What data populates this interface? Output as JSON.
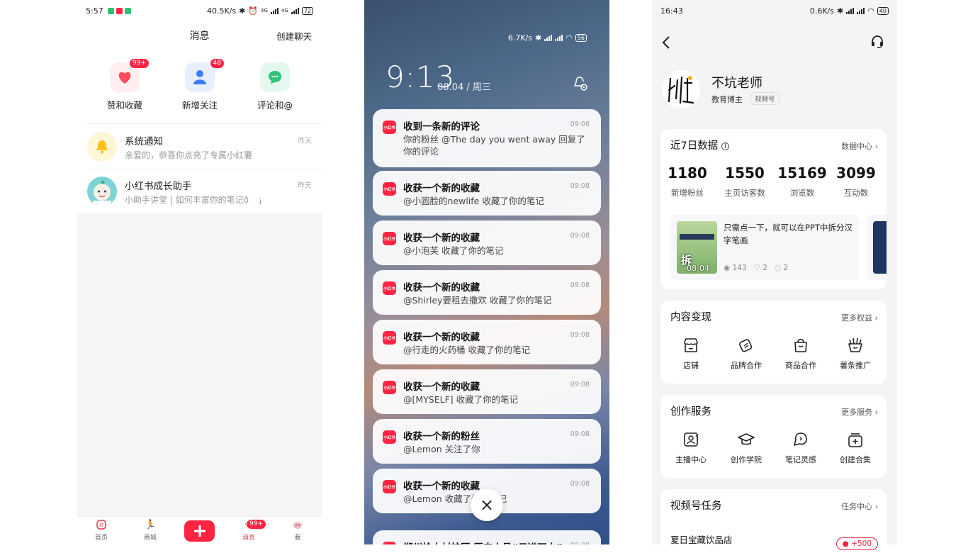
{
  "panel1": {
    "status": {
      "time": "5:57",
      "speed": "40.5K/s",
      "net1": "4G",
      "net2": "4G",
      "battery": "72"
    },
    "title": "消息",
    "create_chat": "创建聊天",
    "categories": [
      {
        "label": "赞和收藏",
        "badge": "99+",
        "icon": "heart-icon",
        "color": "#ff4d5e"
      },
      {
        "label": "新增关注",
        "badge": "48",
        "icon": "person-icon",
        "color": "#3d7cff"
      },
      {
        "label": "评论和@",
        "badge": "",
        "icon": "chat-bubble-icon",
        "color": "#2fc27c"
      }
    ],
    "messages": [
      {
        "title": "系统通知",
        "snippet": "亲爱的，恭喜你点亮了专属小红薯",
        "date": "昨天",
        "icon": "bell-icon"
      },
      {
        "title": "小红书成长助手",
        "snippet": "小助手讲堂 | 如何丰富你的笔记ð",
        "extra": "¡",
        "date": "昨天",
        "icon": "assistant-avatar-icon"
      }
    ],
    "nav": [
      {
        "label": "首页",
        "icon": "home-icon"
      },
      {
        "label": "商城",
        "icon": "mall-icon"
      },
      {
        "label": "",
        "icon": "plus-icon"
      },
      {
        "label": "消息",
        "icon": "message-icon",
        "badge": "99+"
      },
      {
        "label": "我",
        "icon": "me-icon"
      }
    ]
  },
  "panel2": {
    "status": {
      "speed": "6.7K/s",
      "battery": "56"
    },
    "clock": "9:13",
    "date": "08.04 / 周三",
    "app_logo": "小红书",
    "notifications": [
      {
        "title": "收到一条新的评论",
        "text": "你的粉丝 @The day you went away 回复了你的评论",
        "time": "09:08"
      },
      {
        "title": "收获一个新的收藏",
        "text": "@小圆脸的newlife 收藏了你的笔记",
        "time": "09:08"
      },
      {
        "title": "收获一个新的收藏",
        "text": "@小泡芙 收藏了你的笔记",
        "time": "09:08"
      },
      {
        "title": "收获一个新的收藏",
        "text": "@Shirley要租去撒欢 收藏了你的笔记",
        "time": "09:08"
      },
      {
        "title": "收获一个新的收藏",
        "text": "@行走的火药桶 收藏了你的笔记",
        "time": "09:08"
      },
      {
        "title": "收获一个新的收藏",
        "text": "@[MYSELF] 收藏了你的笔记",
        "time": "09:08"
      },
      {
        "title": "收获一个新的粉丝",
        "text": "@Lemon 关注了你",
        "time": "09:08"
      },
      {
        "title": "收获一个新的收藏",
        "text": "@Lemon 收藏了你的笔记",
        "time": "09:08"
      },
      {
        "title": "郑州检木村护区 历史小号“日进下山”",
        "text": "",
        "time": "09:08"
      }
    ],
    "close_glyph": "×"
  },
  "panel3": {
    "status": {
      "time": "16:43",
      "speed": "0.6K/s",
      "battery": "40"
    },
    "profile": {
      "name": "不坑老师",
      "tag": "教育博主",
      "badge": "视频号"
    },
    "stats_title": "近7日数据",
    "stats_more": "数据中心",
    "stats": [
      {
        "value": "1180",
        "label": "新增粉丝"
      },
      {
        "value": "1550",
        "label": "主页访客数"
      },
      {
        "value": "15169",
        "label": "浏览数"
      },
      {
        "value": "3099",
        "label": "互动数"
      }
    ],
    "note": {
      "title": "只需点一下，就可以在PPT中拆分汉字笔画",
      "date": "08-04",
      "views": "143",
      "likes": "2",
      "comments": "2",
      "thumb_char": "拆"
    },
    "monetize": {
      "title": "内容变现",
      "more": "更多权益",
      "items": [
        {
          "label": "店铺",
          "icon": "shop-icon"
        },
        {
          "label": "品牌合作",
          "icon": "brand-icon"
        },
        {
          "label": "商品合作",
          "icon": "bag-icon"
        },
        {
          "label": "薯条推广",
          "icon": "fries-icon"
        }
      ]
    },
    "create": {
      "title": "创作服务",
      "more": "更多服务",
      "items": [
        {
          "label": "主播中心",
          "icon": "anchor-icon"
        },
        {
          "label": "创作学院",
          "icon": "graduation-cap-icon"
        },
        {
          "label": "笔记灵感",
          "icon": "inspiration-icon"
        },
        {
          "label": "创建合集",
          "icon": "collection-icon"
        }
      ]
    },
    "video_tasks": {
      "title": "视频号任务",
      "more": "任务中心",
      "item": "夏日宝藏饮品店",
      "reward": "+500"
    }
  }
}
